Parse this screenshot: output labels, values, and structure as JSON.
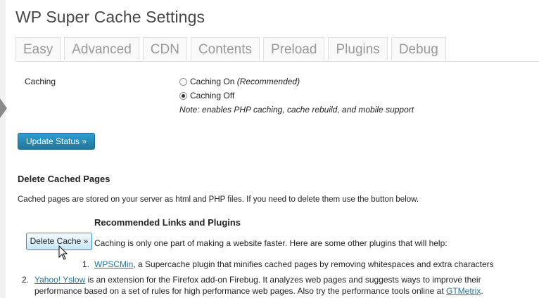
{
  "page": {
    "title": "WP Super Cache Settings"
  },
  "tabs": [
    "Easy",
    "Advanced",
    "CDN",
    "Contents",
    "Preload",
    "Plugins",
    "Debug"
  ],
  "caching": {
    "label": "Caching",
    "option_on": "Caching On",
    "option_on_suffix": "(Recommended)",
    "option_off": "Caching Off",
    "selected": "off",
    "note": "Note: enables PHP caching, cache rebuild, and mobile support"
  },
  "update_button": "Update Status »",
  "delete_section": {
    "heading": "Delete Cached Pages",
    "description": "Cached pages are stored on your server as html and PHP files. If you need to delete them use the button below.",
    "button": "Delete Cache »"
  },
  "recommended": {
    "heading": "Recommended Links and Plugins",
    "description": "Caching is only one part of making a website faster. Here are some other plugins that will help:",
    "items": [
      {
        "num": "1.",
        "link": "WPSCMin",
        "text": ", a Supercache plugin that minifies cached pages by removing whitespaces and extra characters"
      },
      {
        "num": "2.",
        "link": "Yahoo! Yslow",
        "text_line1": " is an extension for the Firefox add-on Firebug. It analyzes web pages and suggests ways to improve their",
        "text_line2": "performance based on a set of rules for high performance web pages. Also try the performance tools online at ",
        "link2": "GTMetrix",
        "text_end": "."
      }
    ]
  }
}
